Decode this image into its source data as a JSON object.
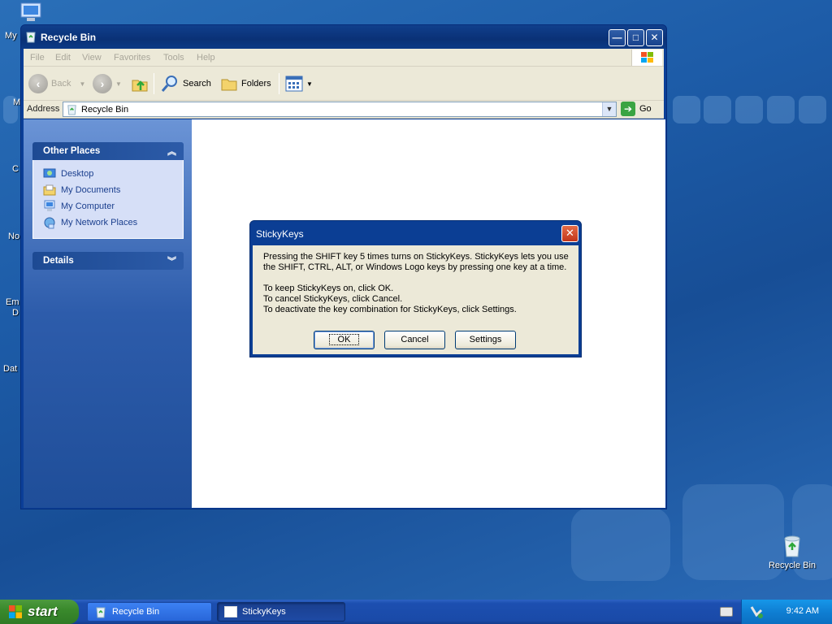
{
  "desktop": {
    "edge_labels": [
      "My",
      "M",
      "C",
      "No",
      "Em",
      "D",
      "Dat"
    ],
    "recycle_bin_icon_label": "Recycle Bin"
  },
  "explorer": {
    "title": "Recycle Bin",
    "controls": {
      "minimize": "—",
      "maximize": "□",
      "close": "✕"
    },
    "menu": [
      "File",
      "Edit",
      "View",
      "Favorites",
      "Tools",
      "Help"
    ],
    "toolbar": {
      "back": "Back",
      "search": "Search",
      "folders": "Folders"
    },
    "address": {
      "label": "Address",
      "value": "Recycle Bin",
      "go": "Go"
    },
    "sidebar": {
      "other_places": {
        "title": "Other Places",
        "items": [
          "Desktop",
          "My Documents",
          "My Computer",
          "My Network Places"
        ]
      },
      "details": {
        "title": "Details"
      }
    }
  },
  "dialog": {
    "title": "StickyKeys",
    "close": "✕",
    "lines": [
      "Pressing the SHIFT key 5 times turns on StickyKeys. StickyKeys lets you use",
      "the SHIFT, CTRL, ALT, or Windows Logo keys by pressing one key at a time.",
      "",
      "To keep StickyKeys on, click OK.",
      "To cancel StickyKeys, click Cancel.",
      "To deactivate the key combination for StickyKeys, click Settings."
    ],
    "buttons": {
      "ok": "OK",
      "cancel": "Cancel",
      "settings": "Settings"
    }
  },
  "taskbar": {
    "start": "start",
    "tasks": [
      {
        "label": "Recycle Bin",
        "active": false
      },
      {
        "label": "StickyKeys",
        "active": true
      }
    ],
    "clock": "9:42 AM"
  }
}
